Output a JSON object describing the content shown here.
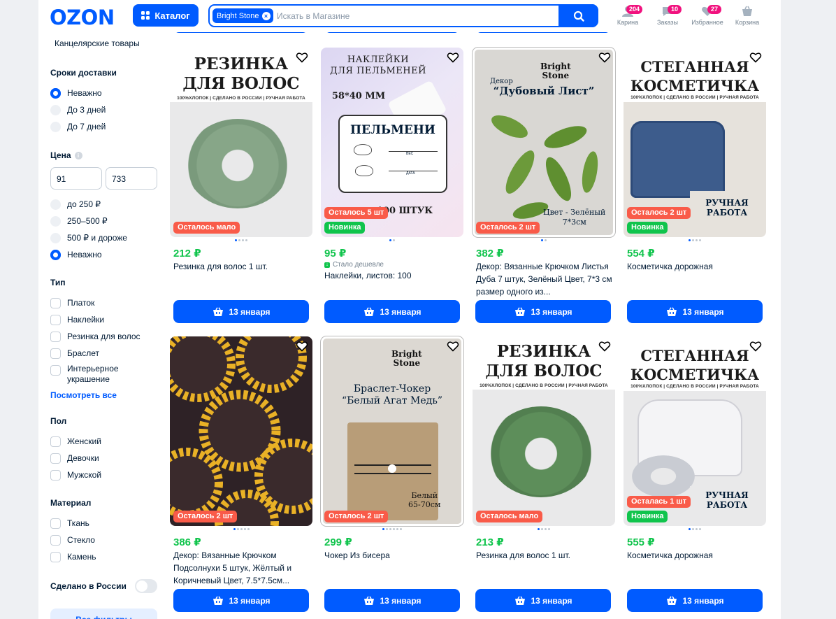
{
  "header": {
    "logo": "OZON",
    "catalog_label": "Каталог",
    "search_chip": "Bright Stone",
    "search_placeholder": "Искать в Магазине",
    "nav": [
      {
        "label": "Карина",
        "badge": "204",
        "icon": "user-icon"
      },
      {
        "label": "Заказы",
        "badge": "10",
        "icon": "box-icon"
      },
      {
        "label": "Избранное",
        "badge": "27",
        "icon": "heart-icon"
      },
      {
        "label": "Корзина",
        "badge": "",
        "icon": "cart-icon"
      }
    ]
  },
  "sidebar": {
    "category": "Канцелярские товары",
    "delivery": {
      "title": "Сроки доставки",
      "options": [
        "Неважно",
        "До 3 дней",
        "До 7 дней"
      ],
      "selected": "Неважно"
    },
    "price": {
      "title": "Цена",
      "min": "91",
      "max": "733",
      "options": [
        "до 250 ₽",
        "250–500 ₽",
        "500 ₽ и дороже",
        "Неважно"
      ],
      "selected": "Неважно"
    },
    "type": {
      "title": "Тип",
      "options": [
        "Платок",
        "Наклейки",
        "Резинка для волос",
        "Браслет",
        "Интерьерное украшение"
      ],
      "show_all": "Посмотреть все"
    },
    "gender": {
      "title": "Пол",
      "options": [
        "Женский",
        "Девочки",
        "Мужской"
      ]
    },
    "material": {
      "title": "Материал",
      "options": [
        "Ткань",
        "Стекло",
        "Камень"
      ]
    },
    "made_in_russia": "Сделано в России",
    "all_filters": "Все фильтры"
  },
  "products": [
    {
      "price": "212 ₽",
      "title": "Резинка для волос 1 шт.",
      "tags": [
        "Осталось мало"
      ],
      "delivery": "13 января",
      "art": {
        "line1": "РЕЗИНКА",
        "line2": "ДЛЯ ВОЛОС",
        "sub": "100%ХЛОПОК | СДЕЛАНО В РОССИИ | РУЧНАЯ РАБОТА"
      }
    },
    {
      "price": "95 ₽",
      "title": "Наклейки, листов: 100",
      "tags": [
        "Осталось 5 шт",
        "Новинка"
      ],
      "delivery": "13 января",
      "note": "Стало дешевле",
      "art": {
        "line1": "НАКЛЕЙКИ",
        "line2": "ДЛЯ ПЕЛЬМЕНЕЙ",
        "size": "58*40 ММ",
        "label": "ПЕЛЬМЕНИ",
        "ves": "ВЕС",
        "data": "ДАТА",
        "count": "100 ШТУК"
      }
    },
    {
      "price": "382 ₽",
      "title": "Декор: Вязанные Крючком Листья Дуба 7 штук, Зелёный Цвет, 7*3 см размер одного из...",
      "tags": [
        "Осталось 2 шт"
      ],
      "delivery": "13 января",
      "art": {
        "brand1": "Bright",
        "brand2": "Stone",
        "pre": "Декор",
        "name": "“Дубовый Лист”",
        "color1": "Цвет - Зелёный",
        "color2": "7*3см"
      }
    },
    {
      "price": "554 ₽",
      "title": "Косметичка дорожная",
      "tags": [
        "Осталось 2 шт",
        "Новинка"
      ],
      "delivery": "13 января",
      "art": {
        "line1": "СТЕГАННАЯ",
        "line2": "КОСМЕТИЧКА",
        "sub": "100%ХЛОПОК | СДЕЛАНО В РОССИИ | РУЧНАЯ РАБОТА",
        "hand": "РУЧНАЯ РАБОТА"
      }
    },
    {
      "price": "386 ₽",
      "title": "Декор: Вязанные Крючком Подсолнухи 5 штук, Жёлтый и Коричневый Цвет, 7.5*7.5см...",
      "tags": [
        "Осталось 2 шт"
      ],
      "delivery": "13 января",
      "art": {}
    },
    {
      "price": "299 ₽",
      "title": "Чокер Из бисера",
      "tags": [
        "Осталось 2 шт"
      ],
      "delivery": "13 января",
      "art": {
        "brand1": "Bright",
        "brand2": "Stone",
        "name1": "Браслет-Чокер",
        "name2": "“Белый Агат Медь”",
        "color1": "Белый",
        "color2": "65-70см"
      }
    },
    {
      "price": "213 ₽",
      "title": "Резинка для волос 1 шт.",
      "tags": [
        "Осталось мало"
      ],
      "delivery": "13 января",
      "art": {
        "line1": "РЕЗИНКА",
        "line2": "ДЛЯ ВОЛОС",
        "sub": "100%ХЛОПОК | СДЕЛАНО В РОССИИ | РУЧНАЯ РАБОТА"
      }
    },
    {
      "price": "555 ₽",
      "title": "Косметичка дорожная",
      "tags": [
        "Осталась 1 шт",
        "Новинка"
      ],
      "delivery": "13 января",
      "art": {
        "line1": "СТЕГАННАЯ",
        "line2": "КОСМЕТИЧКА",
        "sub": "100%ХЛОПОК | СДЕЛАНО В РОССИИ | РУЧНАЯ РАБОТА",
        "hand": "РУЧНАЯ РАБОТА"
      }
    }
  ],
  "colors": {
    "accent": "#005bff",
    "price": "#10c44c",
    "left_tag": "#f95b49",
    "new_tag": "#10c44c",
    "badge": "#f1117e"
  }
}
